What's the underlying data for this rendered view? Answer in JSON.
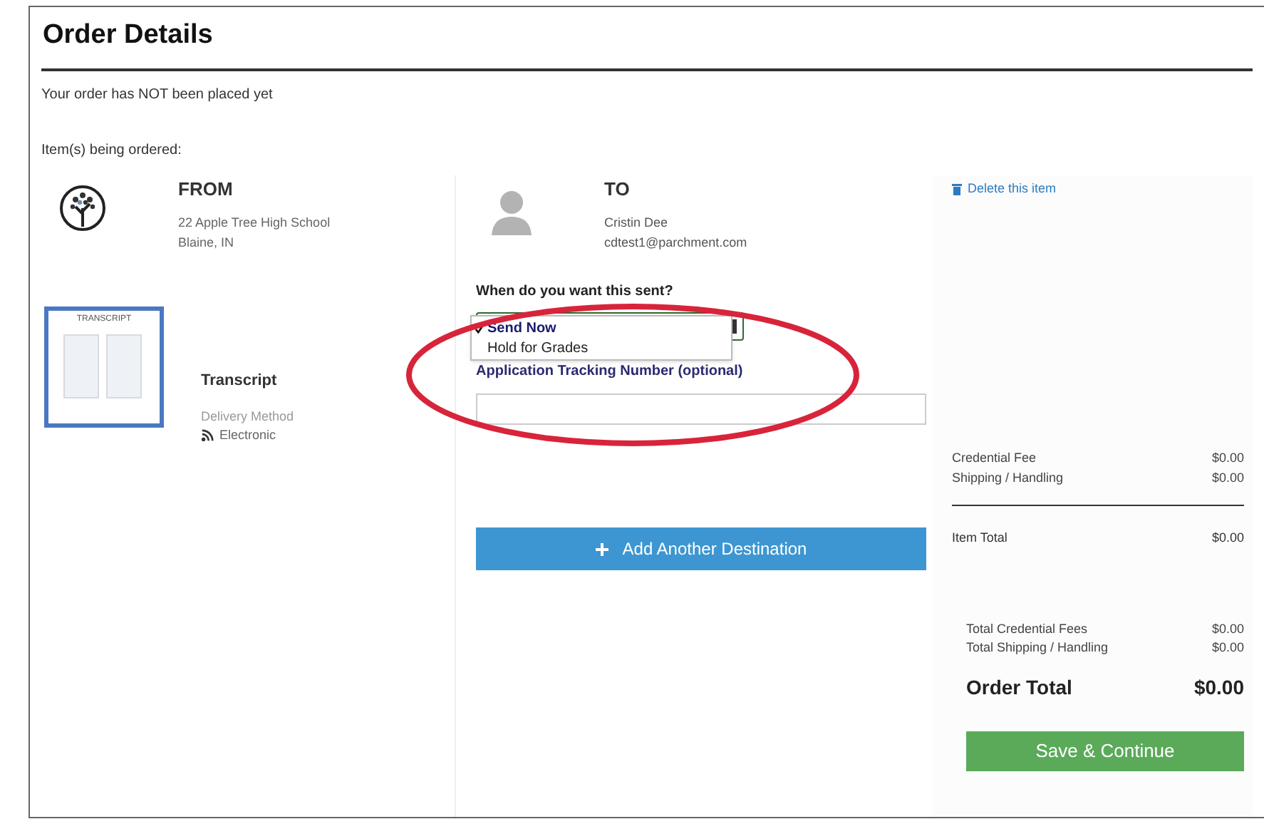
{
  "title": "Order Details",
  "notice": "Your order has NOT been placed yet",
  "items_label": "Item(s) being ordered:",
  "from": {
    "heading": "FROM",
    "lines": [
      "22 Apple Tree High School",
      "Blaine, IN"
    ]
  },
  "document": {
    "thumbnail_label": "TRANSCRIPT",
    "name": "Transcript",
    "delivery_label": "Delivery Method",
    "delivery_value": "Electronic"
  },
  "to": {
    "heading": "TO",
    "lines": [
      "Cristin Dee",
      "cdtest1@parchment.com"
    ]
  },
  "send_time": {
    "label": "When do you want this sent?",
    "options": [
      {
        "label": "Send Now",
        "selected": true
      },
      {
        "label": "Hold for Grades",
        "selected": false
      }
    ]
  },
  "tracking": {
    "label": "Application Tracking Number (optional)"
  },
  "add_destination": "Add Another Destination",
  "delete_link": "Delete this item",
  "item_fees": [
    {
      "label": "Credential Fee",
      "amount": "$0.00"
    },
    {
      "label": "Shipping / Handling",
      "amount": "$0.00"
    }
  ],
  "item_total": {
    "label": "Item Total",
    "amount": "$0.00"
  },
  "order_fees": [
    {
      "label": "Total Credential Fees",
      "amount": "$0.00"
    },
    {
      "label": "Total Shipping / Handling",
      "amount": "$0.00"
    }
  ],
  "order_total": {
    "label": "Order Total",
    "amount": "$0.00"
  },
  "save_button": "Save & Continue"
}
